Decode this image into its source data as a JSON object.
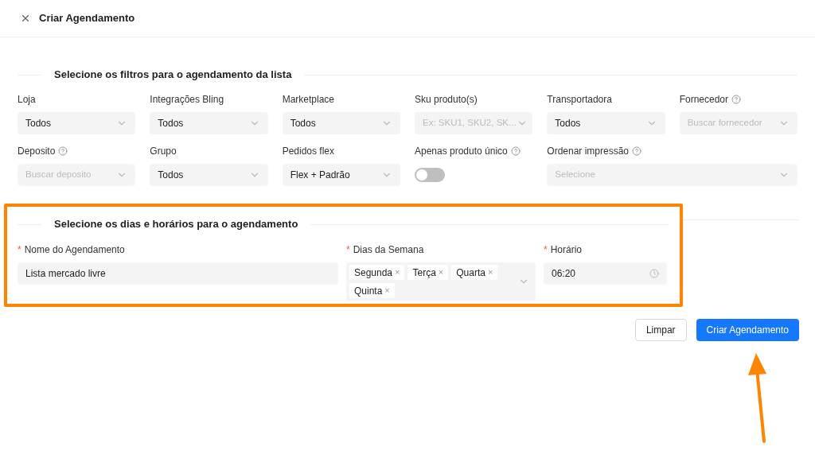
{
  "header": {
    "title": "Criar Agendamento"
  },
  "filters": {
    "title": "Selecione os filtros para o agendamento da lista",
    "fields": [
      {
        "kind": "select",
        "label": "Loja",
        "help": false,
        "value": "Todos"
      },
      {
        "kind": "select",
        "label": "Integrações Bling",
        "help": false,
        "value": "Todos"
      },
      {
        "kind": "select",
        "label": "Marketplace",
        "help": false,
        "value": "Todos"
      },
      {
        "kind": "select",
        "label": "Sku produto(s)",
        "help": false,
        "placeholder": "Ex: SKU1, SKU2, SK..."
      },
      {
        "kind": "select",
        "label": "Transportadora",
        "help": false,
        "value": "Todos"
      },
      {
        "kind": "select",
        "label": "Fornecedor",
        "help": true,
        "placeholder": "Buscar fornecedor"
      },
      {
        "kind": "select",
        "label": "Deposito",
        "help": true,
        "placeholder": "Buscar deposito"
      },
      {
        "kind": "select",
        "label": "Grupo",
        "help": false,
        "value": "Todos"
      },
      {
        "kind": "select",
        "label": "Pedidos flex",
        "help": false,
        "value": "Flex + Padrão"
      },
      {
        "kind": "toggle",
        "label": "Apenas produto único",
        "help": true,
        "on": false
      },
      {
        "kind": "select",
        "label": "Ordenar impressão",
        "help": true,
        "placeholder": "Selecione"
      }
    ]
  },
  "schedule": {
    "title": "Selecione os dias e horários para o agendamento",
    "name": {
      "label": "Nome do Agendamento",
      "required_mark": "*",
      "value": "Lista mercado livre"
    },
    "days": {
      "label": "Dias da Semana",
      "required_mark": "*",
      "tags": [
        "Segunda",
        "Terça",
        "Quarta",
        "Quinta"
      ],
      "remove_icon": "×"
    },
    "time": {
      "label": "Horário",
      "required_mark": "*",
      "value": "06:20"
    }
  },
  "buttons": {
    "clear": "Limpar",
    "submit": "Criar Agendamento"
  }
}
